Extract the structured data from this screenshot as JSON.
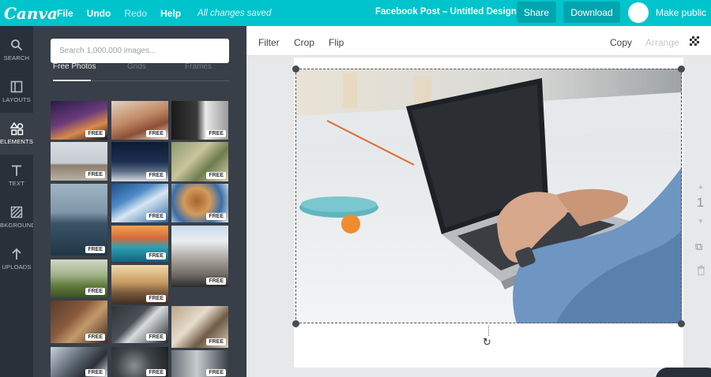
{
  "header": {
    "logo": "Canva",
    "menu": {
      "file": "File",
      "undo": "Undo",
      "redo": "Redo",
      "help": "Help"
    },
    "save_status": "All changes saved",
    "design_title": "Facebook Post – Untitled Design",
    "share_label": "Share",
    "download_label": "Download",
    "make_public_label": "Make public",
    "accent_color": "#00c4cc"
  },
  "rail": {
    "items": [
      {
        "label": "SEARCH",
        "icon": "search-icon"
      },
      {
        "label": "LAYOUTS",
        "icon": "layouts-icon"
      },
      {
        "label": "ELEMENTS",
        "icon": "elements-icon"
      },
      {
        "label": "TEXT",
        "icon": "text-icon"
      },
      {
        "label": "BKGROUND",
        "icon": "background-icon"
      },
      {
        "label": "UPLOADS",
        "icon": "upload-icon"
      }
    ],
    "active": "ELEMENTS"
  },
  "panel": {
    "search_placeholder": "Search 1,000,000 images...",
    "tabs": [
      "Free Photos",
      "Grids",
      "Frames"
    ],
    "active_tab": "Free Photos",
    "badge": "FREE"
  },
  "toolbar": {
    "filter": "Filter",
    "crop": "Crop",
    "flip": "Flip",
    "copy": "Copy",
    "arrange": "Arrange"
  },
  "page_indicator": {
    "number": "1"
  }
}
